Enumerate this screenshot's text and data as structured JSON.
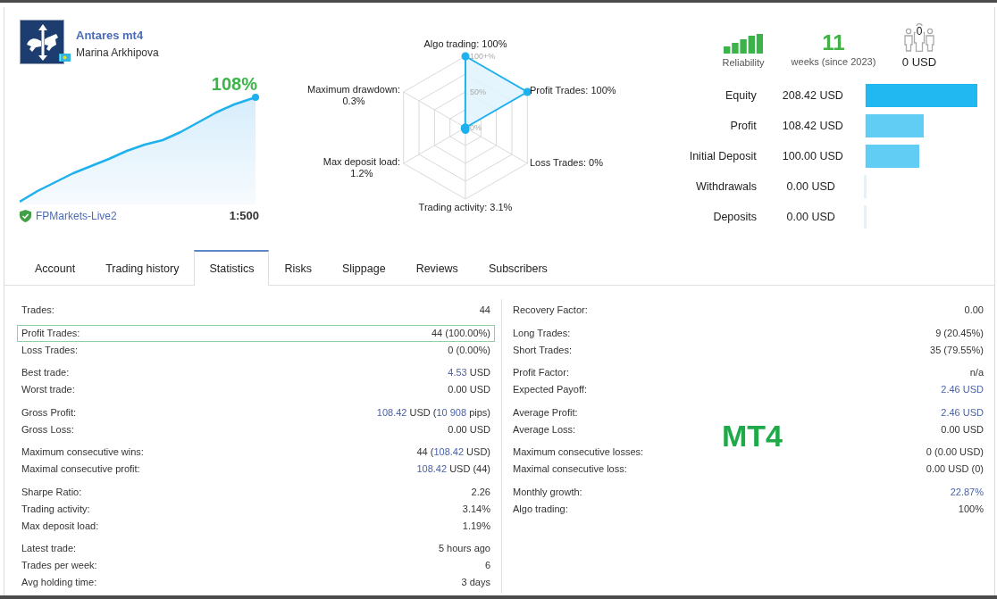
{
  "header": {
    "title": "Antares mt4",
    "author": "Marina Arkhipova",
    "growth": "108%",
    "server": "FPMarkets-Live2",
    "leverage": "1:500"
  },
  "radar": {
    "ticks": [
      "100+%",
      "50%",
      "0%"
    ],
    "axes": [
      {
        "label": "Algo trading:",
        "reading": "100%"
      },
      {
        "label": "Maximum drawdown:",
        "reading": "0.3%"
      },
      {
        "label": "Profit Trades:",
        "reading": "100%"
      },
      {
        "label": "Max deposit load:",
        "reading": "1.2%"
      },
      {
        "label": "Loss Trades:",
        "reading": "0%"
      },
      {
        "label": "Trading activity:",
        "reading": "3.1%"
      }
    ]
  },
  "summary": {
    "reliability": {
      "label": "Reliability"
    },
    "weeks": {
      "value": "11",
      "label": "weeks (since 2023)"
    },
    "subscribers": {
      "count": "0",
      "funds": "0 USD"
    }
  },
  "balance": [
    {
      "label": "Equity",
      "value": "208.42 USD",
      "level": 1,
      "color": "#21b7f0"
    },
    {
      "label": "Profit",
      "value": "108.42 USD",
      "level": 0.52,
      "color": "#62cdf4"
    },
    {
      "label": "Initial Deposit",
      "value": "100.00 USD",
      "level": 0.48,
      "color": "#62cdf4"
    },
    {
      "label": "Withdrawals",
      "value": "0.00 USD",
      "level": 0,
      "color": "#e0f2fb"
    },
    {
      "label": "Deposits",
      "value": "0.00 USD",
      "level": 0,
      "color": "#e0f2fb"
    }
  ],
  "tabs": [
    {
      "label": "Account",
      "selected": false
    },
    {
      "label": "Trading history",
      "selected": false
    },
    {
      "label": "Statistics",
      "selected": true
    },
    {
      "label": "Risks",
      "selected": false
    },
    {
      "label": "Slippage",
      "selected": false
    },
    {
      "label": "Reviews",
      "selected": false
    },
    {
      "label": "Subscribers",
      "selected": false
    }
  ],
  "stats": {
    "left": [
      [
        {
          "label": "Trades:",
          "value": [
            {
              "text": "44",
              "accent": false
            }
          ],
          "highlighted": false
        }
      ],
      [
        {
          "label": "Profit Trades:",
          "value": [
            {
              "text": "44 (100.00%)",
              "accent": false
            }
          ],
          "highlighted": true
        },
        {
          "label": "Loss Trades:",
          "value": [
            {
              "text": "0 (0.00%)",
              "accent": false
            }
          ],
          "highlighted": false
        }
      ],
      [
        {
          "label": "Best trade:",
          "value": [
            {
              "text": "4.53",
              "accent": true
            },
            {
              "text": " USD",
              "accent": false
            }
          ],
          "highlighted": false
        },
        {
          "label": "Worst trade:",
          "value": [
            {
              "text": "0.00 USD",
              "accent": false
            }
          ],
          "highlighted": false
        }
      ],
      [
        {
          "label": "Gross Profit:",
          "value": [
            {
              "text": "108.42",
              "accent": true
            },
            {
              "text": " USD (",
              "accent": false
            },
            {
              "text": "10 908",
              "accent": true
            },
            {
              "text": " pips)",
              "accent": false
            }
          ],
          "highlighted": false
        },
        {
          "label": "Gross Loss:",
          "value": [
            {
              "text": "0.00 USD",
              "accent": false
            }
          ],
          "highlighted": false
        }
      ],
      [
        {
          "label": "Maximum consecutive wins:",
          "value": [
            {
              "text": "44 (",
              "accent": false
            },
            {
              "text": "108.42",
              "accent": true
            },
            {
              "text": " USD)",
              "accent": false
            }
          ],
          "highlighted": false
        },
        {
          "label": "Maximal consecutive profit:",
          "value": [
            {
              "text": "108.42",
              "accent": true
            },
            {
              "text": " USD (44)",
              "accent": false
            }
          ],
          "highlighted": false
        }
      ],
      [
        {
          "label": "Sharpe Ratio:",
          "value": [
            {
              "text": "2.26",
              "accent": false
            }
          ],
          "highlighted": false
        },
        {
          "label": "Trading activity:",
          "value": [
            {
              "text": "3.14%",
              "accent": false
            }
          ],
          "highlighted": false
        },
        {
          "label": "Max deposit load:",
          "value": [
            {
              "text": "1.19%",
              "accent": false
            }
          ],
          "highlighted": false
        }
      ],
      [
        {
          "label": "Latest trade:",
          "value": [
            {
              "text": "5 hours ago",
              "accent": false
            }
          ],
          "highlighted": false
        },
        {
          "label": "Trades per week:",
          "value": [
            {
              "text": "6",
              "accent": false
            }
          ],
          "highlighted": false
        },
        {
          "label": "Avg holding time:",
          "value": [
            {
              "text": "3 days",
              "accent": false
            }
          ],
          "highlighted": false
        }
      ]
    ],
    "right": [
      [
        {
          "label": "Recovery Factor:",
          "value": [
            {
              "text": "0.00",
              "accent": false
            }
          ],
          "highlighted": false
        }
      ],
      [
        {
          "label": "Long Trades:",
          "value": [
            {
              "text": "9 (20.45%)",
              "accent": false
            }
          ],
          "highlighted": false
        },
        {
          "label": "Short Trades:",
          "value": [
            {
              "text": "35 (79.55%)",
              "accent": false
            }
          ],
          "highlighted": false
        }
      ],
      [
        {
          "label": "Profit Factor:",
          "value": [
            {
              "text": "n/a",
              "accent": false
            }
          ],
          "highlighted": false
        },
        {
          "label": "Expected Payoff:",
          "value": [
            {
              "text": "2.46 USD",
              "accent": true
            }
          ],
          "highlighted": false
        }
      ],
      [
        {
          "label": "Average Profit:",
          "value": [
            {
              "text": "2.46 USD",
              "accent": true
            }
          ],
          "highlighted": false
        },
        {
          "label": "Average Loss:",
          "value": [
            {
              "text": "0.00 USD",
              "accent": false
            }
          ],
          "highlighted": false
        }
      ],
      [
        {
          "label": "Maximum consecutive losses:",
          "value": [
            {
              "text": "0 (0.00 USD)",
              "accent": false
            }
          ],
          "highlighted": false
        },
        {
          "label": "Maximal consecutive loss:",
          "value": [
            {
              "text": "0.00 USD (0)",
              "accent": false
            }
          ],
          "highlighted": false
        }
      ],
      [
        {
          "label": "Monthly growth:",
          "value": [
            {
              "text": "22.87%",
              "accent": true
            }
          ],
          "highlighted": false
        },
        {
          "label": "Algo trading:",
          "value": [
            {
              "text": "100%",
              "accent": false
            }
          ],
          "highlighted": false
        }
      ]
    ]
  },
  "overlay_label": "MT4"
}
